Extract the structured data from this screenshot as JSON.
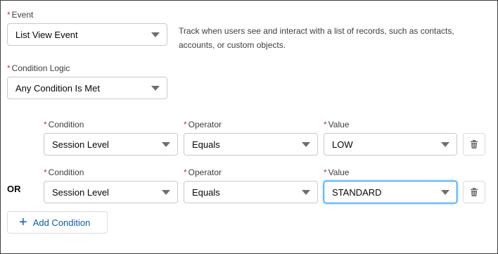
{
  "event": {
    "label": "Event",
    "required_mark": "*",
    "value": "List View Event",
    "help_text": "Track when users see and interact with a list of records, such as contacts, accounts, or custom objects."
  },
  "condition_logic": {
    "label": "Condition Logic",
    "required_mark": "*",
    "value": "Any Condition Is Met"
  },
  "conditions": [
    {
      "condition_label": "Condition",
      "operator_label": "Operator",
      "value_label": "Value",
      "condition_value": "Session Level",
      "operator_value": "Equals",
      "value_value": "LOW"
    },
    {
      "connector": "OR",
      "condition_label": "Condition",
      "operator_label": "Operator",
      "value_label": "Value",
      "condition_value": "Session Level",
      "operator_value": "Equals",
      "value_value": "STANDARD"
    }
  ],
  "add_condition": {
    "label": "Add Condition",
    "icon": "plus-icon"
  },
  "delete_icon": "trash-icon",
  "colors": {
    "required": "#c23934",
    "link": "#0b5cab",
    "focus": "#1b96ff"
  }
}
